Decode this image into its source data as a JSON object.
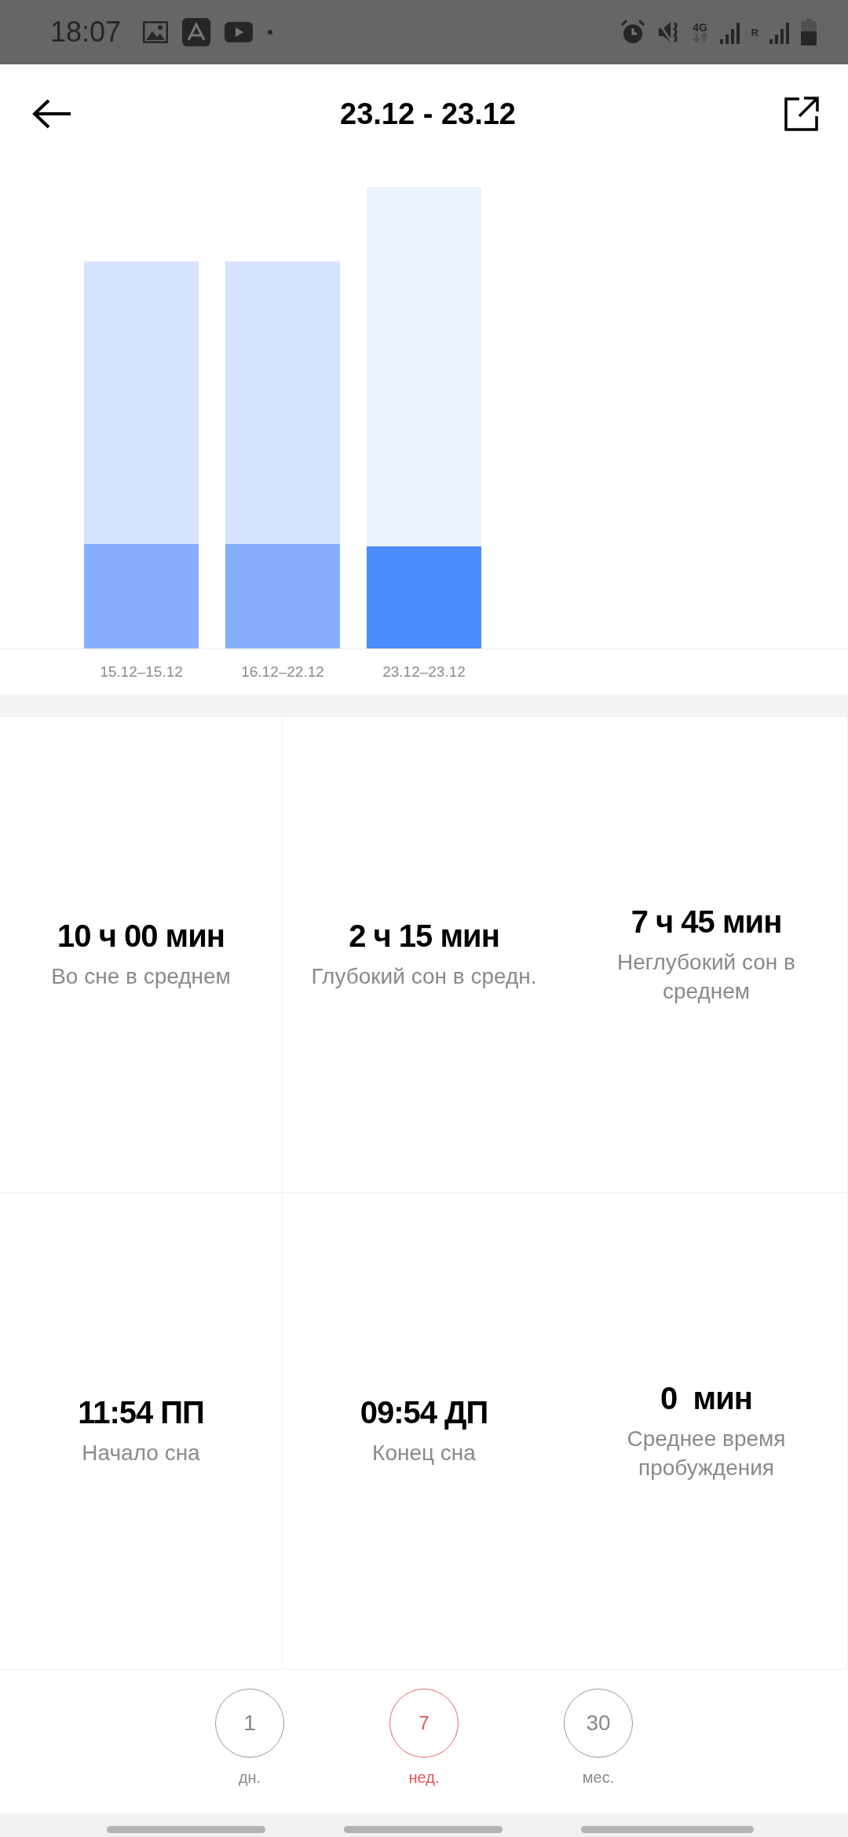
{
  "status_bar": {
    "time": "18:07",
    "network": "4G",
    "roaming": "R"
  },
  "header": {
    "title": "23.12 - 23.12"
  },
  "chart": {
    "bars": [
      {
        "label": "15.12–15.12",
        "selected": false
      },
      {
        "label": "16.12–22.12",
        "selected": false
      },
      {
        "label": "23.12–23.12",
        "selected": true
      }
    ]
  },
  "stats": [
    {
      "value": "10 ч 00 мин",
      "label": "Во сне в среднем"
    },
    {
      "value": "2 ч 15 мин",
      "label": "Глубокий сон в средн."
    },
    {
      "value": "7 ч 45 мин",
      "label": "Неглубокий сон в среднем"
    },
    {
      "value": "11:54 ПП",
      "label": "Начало сна"
    },
    {
      "value": "09:54 ДП",
      "label": "Конец сна"
    },
    {
      "value": "0  мин",
      "label": "Среднее время пробуждения"
    }
  ],
  "periods": [
    {
      "number": "1",
      "label": "дн.",
      "selected": false
    },
    {
      "number": "7",
      "label": "нед.",
      "selected": true
    },
    {
      "number": "30",
      "label": "мес.",
      "selected": false
    }
  ]
}
